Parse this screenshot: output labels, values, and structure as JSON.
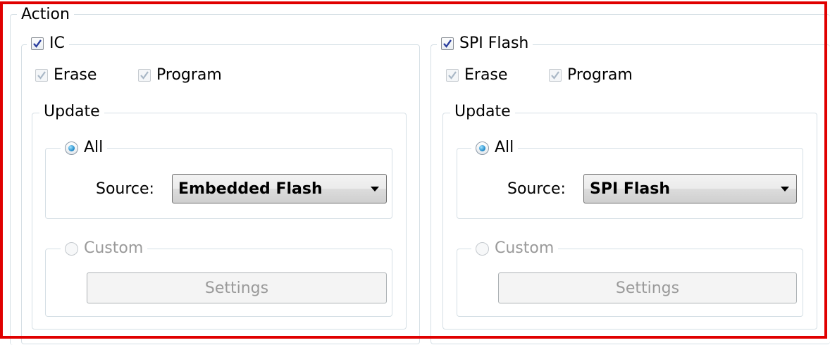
{
  "action": {
    "title": "Action"
  },
  "panels": [
    {
      "title": "IC",
      "checked": true,
      "erase_label": "Erase",
      "program_label": "Program",
      "update_title": "Update",
      "all_label": "All",
      "source_label": "Source:",
      "source_value": "Embedded Flash",
      "custom_label": "Custom",
      "settings_label": "Settings"
    },
    {
      "title": "SPI Flash",
      "checked": true,
      "erase_label": "Erase",
      "program_label": "Program",
      "update_title": "Update",
      "all_label": "All",
      "source_label": "Source:",
      "source_value": "SPI Flash",
      "custom_label": "Custom",
      "settings_label": "Settings"
    }
  ],
  "colors": {
    "highlight_frame": "#e00000",
    "groupbox_border": "#d5dfe5",
    "radio_selected": "#1c86c6"
  },
  "icons": {
    "check": "check-icon",
    "dropdown": "chevron-down-icon"
  }
}
